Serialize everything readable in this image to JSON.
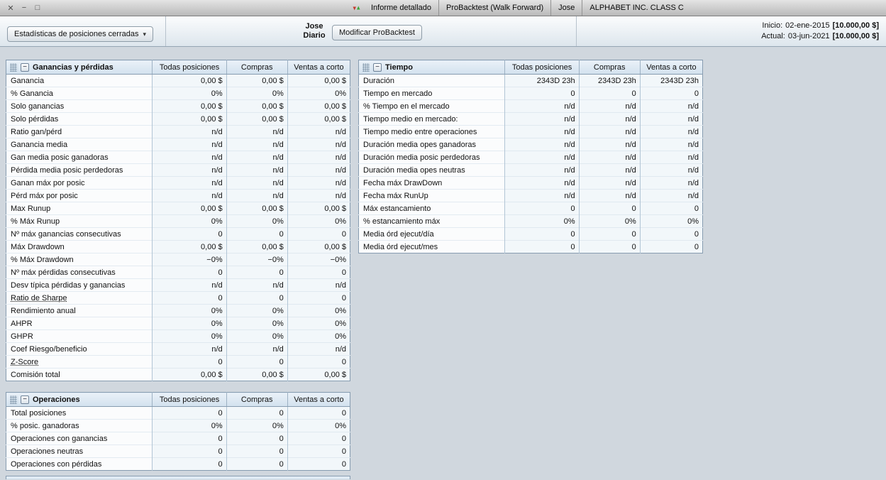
{
  "icons": {
    "caret": "▾",
    "collapse": "−"
  },
  "window": {
    "controls": {
      "close": "✕",
      "minimize": "−",
      "maximize": "□"
    },
    "title_items": [
      "Informe detallado",
      "ProBacktest (Walk Forward)",
      "Jose",
      "ALPHABET INC. CLASS C"
    ]
  },
  "toolbar": {
    "stats_dropdown": "Estadísticas de posiciones cerradas",
    "user_line1": "Jose",
    "user_line2": "Diario",
    "modify_button": "Modificar ProBacktest",
    "inicio": {
      "label": "Inicio:",
      "date": "02-ene-2015",
      "amount": "[10.000,00 $]"
    },
    "actual": {
      "label": "Actual:",
      "date": "03-jun-2021",
      "amount": "[10.000,00 $]"
    }
  },
  "columns": [
    "Todas posiciones",
    "Compras",
    "Ventas a corto"
  ],
  "panels": [
    {
      "title": "Ganancias y pérdidas",
      "rows": [
        {
          "label": "Ganancia",
          "values": [
            "0,00 $",
            "0,00 $",
            "0,00 $"
          ]
        },
        {
          "label": "% Ganancia",
          "values": [
            "0%",
            "0%",
            "0%"
          ]
        },
        {
          "label": "Solo ganancias",
          "values": [
            "0,00 $",
            "0,00 $",
            "0,00 $"
          ]
        },
        {
          "label": "Solo pérdidas",
          "values": [
            "0,00 $",
            "0,00 $",
            "0,00 $"
          ]
        },
        {
          "label": "Ratio gan/pérd",
          "values": [
            "n/d",
            "n/d",
            "n/d"
          ]
        },
        {
          "label": "Ganancia media",
          "values": [
            "n/d",
            "n/d",
            "n/d"
          ]
        },
        {
          "label": "Gan media posic ganadoras",
          "values": [
            "n/d",
            "n/d",
            "n/d"
          ]
        },
        {
          "label": "Pérdida media posic perdedoras",
          "values": [
            "n/d",
            "n/d",
            "n/d"
          ]
        },
        {
          "label": "Ganan máx por posic",
          "values": [
            "n/d",
            "n/d",
            "n/d"
          ]
        },
        {
          "label": "Pérd máx por posic",
          "values": [
            "n/d",
            "n/d",
            "n/d"
          ]
        },
        {
          "label": "Max Runup",
          "values": [
            "0,00 $",
            "0,00 $",
            "0,00 $"
          ]
        },
        {
          "label": "% Máx Runup",
          "values": [
            "0%",
            "0%",
            "0%"
          ]
        },
        {
          "label": "Nº máx ganancias consecutivas",
          "values": [
            "0",
            "0",
            "0"
          ]
        },
        {
          "label": "Máx Drawdown",
          "values": [
            "0,00 $",
            "0,00 $",
            "0,00 $"
          ]
        },
        {
          "label": "% Máx Drawdown",
          "values": [
            "−0%",
            "−0%",
            "−0%"
          ]
        },
        {
          "label": "Nº máx pérdidas consecutivas",
          "values": [
            "0",
            "0",
            "0"
          ]
        },
        {
          "label": "Desv típica pérdidas y ganancias",
          "values": [
            "n/d",
            "n/d",
            "n/d"
          ]
        },
        {
          "label": "Ratio de Sharpe",
          "link": true,
          "values": [
            "0",
            "0",
            "0"
          ]
        },
        {
          "label": "Rendimiento anual",
          "values": [
            "0%",
            "0%",
            "0%"
          ]
        },
        {
          "label": "AHPR",
          "values": [
            "0%",
            "0%",
            "0%"
          ]
        },
        {
          "label": "GHPR",
          "values": [
            "0%",
            "0%",
            "0%"
          ]
        },
        {
          "label": "Coef Riesgo/beneficio",
          "values": [
            "n/d",
            "n/d",
            "n/d"
          ]
        },
        {
          "label": "Z-Score",
          "link": true,
          "values": [
            "0",
            "0",
            "0"
          ]
        },
        {
          "label": "Comisión total",
          "values": [
            "0,00 $",
            "0,00 $",
            "0,00 $"
          ]
        }
      ]
    },
    {
      "title": "Tiempo",
      "rows": [
        {
          "label": "Duración",
          "values": [
            "2343D 23h",
            "2343D 23h",
            "2343D 23h"
          ]
        },
        {
          "label": "Tiempo en mercado",
          "values": [
            "0",
            "0",
            "0"
          ]
        },
        {
          "label": "% Tiempo en el mercado",
          "values": [
            "n/d",
            "n/d",
            "n/d"
          ]
        },
        {
          "label": "Tiempo medio en mercado:",
          "values": [
            "n/d",
            "n/d",
            "n/d"
          ]
        },
        {
          "label": "Tiempo medio entre operaciones",
          "values": [
            "n/d",
            "n/d",
            "n/d"
          ]
        },
        {
          "label": "Duración media opes ganadoras",
          "values": [
            "n/d",
            "n/d",
            "n/d"
          ]
        },
        {
          "label": "Duración media posic perdedoras",
          "values": [
            "n/d",
            "n/d",
            "n/d"
          ]
        },
        {
          "label": "Duración media opes neutras",
          "values": [
            "n/d",
            "n/d",
            "n/d"
          ]
        },
        {
          "label": "Fecha máx DrawDown",
          "values": [
            "n/d",
            "n/d",
            "n/d"
          ]
        },
        {
          "label": "Fecha máx RunUp",
          "values": [
            "n/d",
            "n/d",
            "n/d"
          ]
        },
        {
          "label": "Máx estancamiento",
          "values": [
            "0",
            "0",
            "0"
          ]
        },
        {
          "label": "% estancamiento máx",
          "values": [
            "0%",
            "0%",
            "0%"
          ]
        },
        {
          "label": "Media órd ejecut/día",
          "values": [
            "0",
            "0",
            "0"
          ]
        },
        {
          "label": "Media órd ejecut/mes",
          "values": [
            "0",
            "0",
            "0"
          ]
        }
      ]
    },
    {
      "title": "Operaciones",
      "rows": [
        {
          "label": "Total posiciones",
          "values": [
            "0",
            "0",
            "0"
          ]
        },
        {
          "label": "% posic. ganadoras",
          "values": [
            "0%",
            "0%",
            "0%"
          ]
        },
        {
          "label": "Operaciones con ganancias",
          "values": [
            "0",
            "0",
            "0"
          ]
        },
        {
          "label": "Operaciones neutras",
          "values": [
            "0",
            "0",
            "0"
          ]
        },
        {
          "label": "Operaciones con pérdidas",
          "values": [
            "0",
            "0",
            "0"
          ]
        }
      ]
    }
  ]
}
